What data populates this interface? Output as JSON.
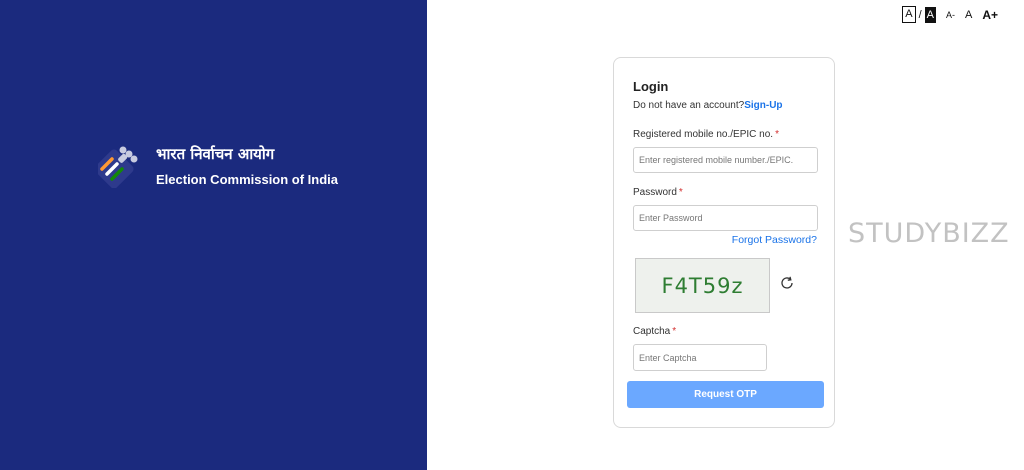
{
  "brand": {
    "hindi_name": "भारत निर्वाचन आयोग",
    "english_name": "Election Commission of India",
    "logo_icon": "eci-ballot-logo-icon"
  },
  "font_controls": {
    "contrast_light": "A",
    "separator": "/",
    "contrast_dark": "A",
    "decrease": "A-",
    "normal": "A",
    "increase": "A+"
  },
  "login": {
    "title": "Login",
    "no_account_text": "Do not have an account?",
    "signup_link": "Sign-Up",
    "mobile_label": "Registered mobile no./EPIC no.",
    "mobile_placeholder": "Enter registered mobile number./EPIC.",
    "mobile_value": "",
    "password_label": "Password",
    "password_placeholder": "Enter Password",
    "password_value": "",
    "forgot_password": "Forgot Password?",
    "captcha_text": "F4T59z",
    "refresh_icon": "refresh-icon",
    "captcha_label": "Captcha",
    "captcha_placeholder": "Enter Captcha",
    "captcha_value": "",
    "required_marker": "*",
    "submit_button": "Request OTP"
  },
  "watermark": "STUDYBIZZ",
  "colors": {
    "left_panel_bg": "#1b2a7e",
    "link": "#1a73e8",
    "required": "#d32f2f",
    "button_bg": "#6ba8ff",
    "captcha_text": "#2e7d32"
  }
}
